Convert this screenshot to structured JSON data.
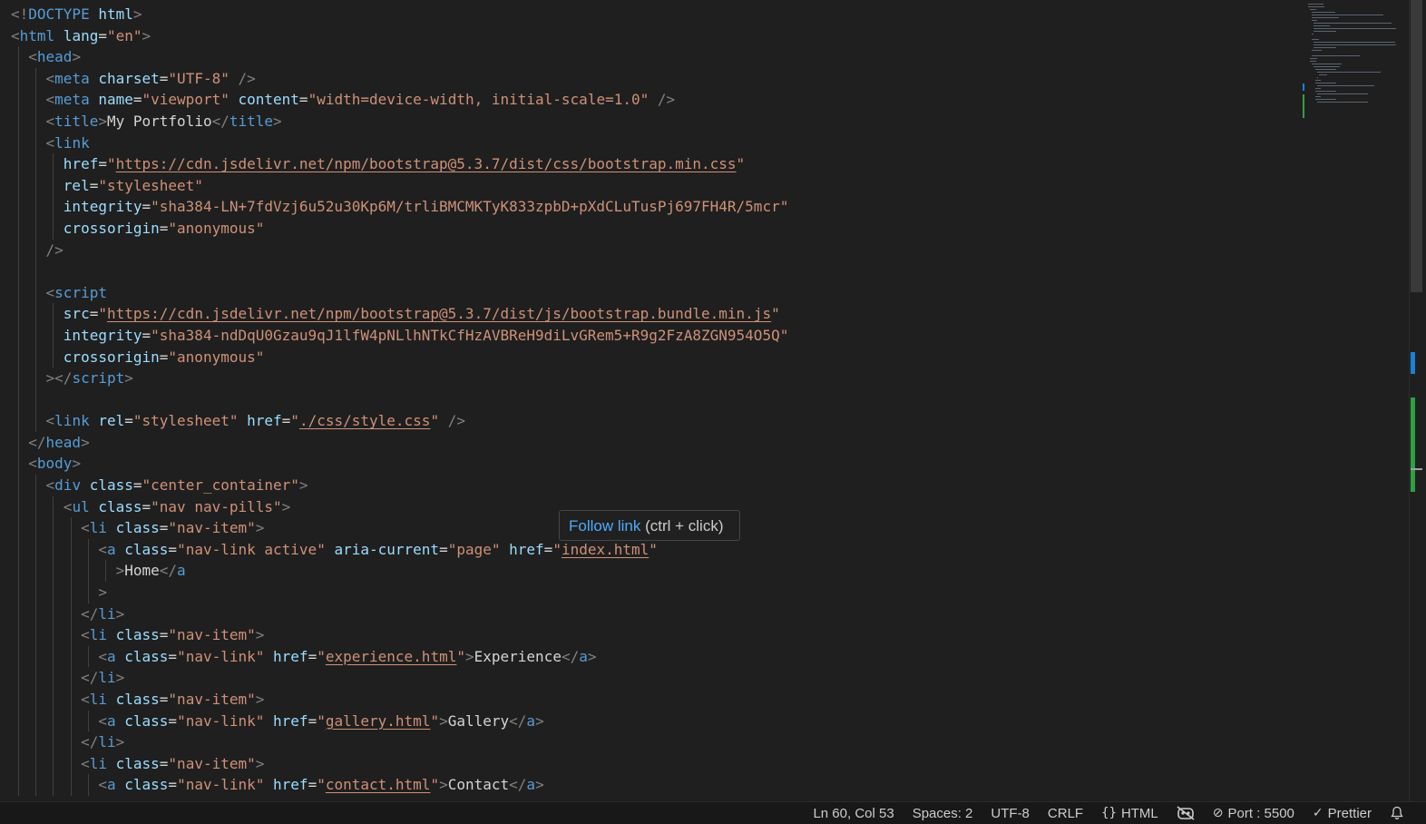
{
  "colors": {
    "background": "#1f1f1f",
    "tag": "#569cd6",
    "attribute": "#9cdcfe",
    "string": "#ce9178",
    "text": "#d4d4d4",
    "punctuation": "#808080",
    "link": "#4daafc"
  },
  "editor": {
    "lines": [
      {
        "indent": 0,
        "tokens": [
          {
            "t": "p",
            "v": "<!"
          },
          {
            "t": "tag",
            "v": "DOCTYPE"
          },
          {
            "t": "txt",
            "v": " "
          },
          {
            "t": "attr",
            "v": "html"
          },
          {
            "t": "p",
            "v": ">"
          }
        ]
      },
      {
        "indent": 0,
        "tokens": [
          {
            "t": "p",
            "v": "<"
          },
          {
            "t": "tag",
            "v": "html"
          },
          {
            "t": "txt",
            "v": " "
          },
          {
            "t": "attr",
            "v": "lang"
          },
          {
            "t": "txt",
            "v": "="
          },
          {
            "t": "str",
            "v": "\"en\""
          },
          {
            "t": "p",
            "v": ">"
          }
        ]
      },
      {
        "indent": 1,
        "tokens": [
          {
            "t": "p",
            "v": "<"
          },
          {
            "t": "tag",
            "v": "head"
          },
          {
            "t": "p",
            "v": ">"
          }
        ]
      },
      {
        "indent": 2,
        "tokens": [
          {
            "t": "p",
            "v": "<"
          },
          {
            "t": "tag",
            "v": "meta"
          },
          {
            "t": "txt",
            "v": " "
          },
          {
            "t": "attr",
            "v": "charset"
          },
          {
            "t": "txt",
            "v": "="
          },
          {
            "t": "str",
            "v": "\"UTF-8\""
          },
          {
            "t": "txt",
            "v": " "
          },
          {
            "t": "p",
            "v": "/>"
          }
        ]
      },
      {
        "indent": 2,
        "tokens": [
          {
            "t": "p",
            "v": "<"
          },
          {
            "t": "tag",
            "v": "meta"
          },
          {
            "t": "txt",
            "v": " "
          },
          {
            "t": "attr",
            "v": "name"
          },
          {
            "t": "txt",
            "v": "="
          },
          {
            "t": "str",
            "v": "\"viewport\""
          },
          {
            "t": "txt",
            "v": " "
          },
          {
            "t": "attr",
            "v": "content"
          },
          {
            "t": "txt",
            "v": "="
          },
          {
            "t": "str",
            "v": "\"width=device-width, initial-scale=1.0\""
          },
          {
            "t": "txt",
            "v": " "
          },
          {
            "t": "p",
            "v": "/>"
          }
        ]
      },
      {
        "indent": 2,
        "tokens": [
          {
            "t": "p",
            "v": "<"
          },
          {
            "t": "tag",
            "v": "title"
          },
          {
            "t": "p",
            "v": ">"
          },
          {
            "t": "txt",
            "v": "My Portfolio"
          },
          {
            "t": "p",
            "v": "</"
          },
          {
            "t": "tag",
            "v": "title"
          },
          {
            "t": "p",
            "v": ">"
          }
        ]
      },
      {
        "indent": 2,
        "tokens": [
          {
            "t": "p",
            "v": "<"
          },
          {
            "t": "tag",
            "v": "link"
          }
        ]
      },
      {
        "indent": 3,
        "tokens": [
          {
            "t": "attr",
            "v": "href"
          },
          {
            "t": "txt",
            "v": "="
          },
          {
            "t": "str",
            "v": "\""
          },
          {
            "t": "str",
            "v": "https://cdn.jsdelivr.net/npm/bootstrap@5.3.7/dist/css/bootstrap.min.css",
            "link": true
          },
          {
            "t": "str",
            "v": "\""
          }
        ]
      },
      {
        "indent": 3,
        "tokens": [
          {
            "t": "attr",
            "v": "rel"
          },
          {
            "t": "txt",
            "v": "="
          },
          {
            "t": "str",
            "v": "\"stylesheet\""
          }
        ]
      },
      {
        "indent": 3,
        "tokens": [
          {
            "t": "attr",
            "v": "integrity"
          },
          {
            "t": "txt",
            "v": "="
          },
          {
            "t": "str",
            "v": "\"sha384-LN+7fdVzj6u52u30Kp6M/trliBMCMKTyK833zpbD+pXdCLuTusPj697FH4R/5mcr\""
          }
        ]
      },
      {
        "indent": 3,
        "tokens": [
          {
            "t": "attr",
            "v": "crossorigin"
          },
          {
            "t": "txt",
            "v": "="
          },
          {
            "t": "str",
            "v": "\"anonymous\""
          }
        ]
      },
      {
        "indent": 2,
        "tokens": [
          {
            "t": "p",
            "v": "/>"
          }
        ]
      },
      {
        "indent": 2,
        "tokens": []
      },
      {
        "indent": 2,
        "tokens": [
          {
            "t": "p",
            "v": "<"
          },
          {
            "t": "tag",
            "v": "script"
          }
        ]
      },
      {
        "indent": 3,
        "tokens": [
          {
            "t": "attr",
            "v": "src"
          },
          {
            "t": "txt",
            "v": "="
          },
          {
            "t": "str",
            "v": "\""
          },
          {
            "t": "str",
            "v": "https://cdn.jsdelivr.net/npm/bootstrap@5.3.7/dist/js/bootstrap.bundle.min.js",
            "link": true
          },
          {
            "t": "str",
            "v": "\""
          }
        ]
      },
      {
        "indent": 3,
        "tokens": [
          {
            "t": "attr",
            "v": "integrity"
          },
          {
            "t": "txt",
            "v": "="
          },
          {
            "t": "str",
            "v": "\"sha384-ndDqU0Gzau9qJ1lfW4pNLlhNTkCfHzAVBReH9diLvGRem5+R9g2FzA8ZGN954O5Q\""
          }
        ]
      },
      {
        "indent": 3,
        "tokens": [
          {
            "t": "attr",
            "v": "crossorigin"
          },
          {
            "t": "txt",
            "v": "="
          },
          {
            "t": "str",
            "v": "\"anonymous\""
          }
        ]
      },
      {
        "indent": 2,
        "tokens": [
          {
            "t": "p",
            "v": "></"
          },
          {
            "t": "tag",
            "v": "script"
          },
          {
            "t": "p",
            "v": ">"
          }
        ]
      },
      {
        "indent": 2,
        "tokens": []
      },
      {
        "indent": 2,
        "tokens": [
          {
            "t": "p",
            "v": "<"
          },
          {
            "t": "tag",
            "v": "link"
          },
          {
            "t": "txt",
            "v": " "
          },
          {
            "t": "attr",
            "v": "rel"
          },
          {
            "t": "txt",
            "v": "="
          },
          {
            "t": "str",
            "v": "\"stylesheet\""
          },
          {
            "t": "txt",
            "v": " "
          },
          {
            "t": "attr",
            "v": "href"
          },
          {
            "t": "txt",
            "v": "="
          },
          {
            "t": "str",
            "v": "\""
          },
          {
            "t": "str",
            "v": "./css/style.css",
            "link": true
          },
          {
            "t": "str",
            "v": "\""
          },
          {
            "t": "txt",
            "v": " "
          },
          {
            "t": "p",
            "v": "/>"
          }
        ]
      },
      {
        "indent": 1,
        "tokens": [
          {
            "t": "p",
            "v": "</"
          },
          {
            "t": "tag",
            "v": "head"
          },
          {
            "t": "p",
            "v": ">"
          }
        ]
      },
      {
        "indent": 1,
        "tokens": [
          {
            "t": "p",
            "v": "<"
          },
          {
            "t": "tag",
            "v": "body"
          },
          {
            "t": "p",
            "v": ">"
          }
        ]
      },
      {
        "indent": 2,
        "tokens": [
          {
            "t": "p",
            "v": "<"
          },
          {
            "t": "tag",
            "v": "div"
          },
          {
            "t": "txt",
            "v": " "
          },
          {
            "t": "attr",
            "v": "class"
          },
          {
            "t": "txt",
            "v": "="
          },
          {
            "t": "str",
            "v": "\"center_container\""
          },
          {
            "t": "p",
            "v": ">"
          }
        ]
      },
      {
        "indent": 3,
        "tokens": [
          {
            "t": "p",
            "v": "<"
          },
          {
            "t": "tag",
            "v": "ul"
          },
          {
            "t": "txt",
            "v": " "
          },
          {
            "t": "attr",
            "v": "class"
          },
          {
            "t": "txt",
            "v": "="
          },
          {
            "t": "str",
            "v": "\"nav nav-pills\""
          },
          {
            "t": "p",
            "v": ">"
          }
        ]
      },
      {
        "indent": 4,
        "tokens": [
          {
            "t": "p",
            "v": "<"
          },
          {
            "t": "tag",
            "v": "li"
          },
          {
            "t": "txt",
            "v": " "
          },
          {
            "t": "attr",
            "v": "class"
          },
          {
            "t": "txt",
            "v": "="
          },
          {
            "t": "str",
            "v": "\"nav-item\""
          },
          {
            "t": "p",
            "v": ">"
          }
        ]
      },
      {
        "indent": 5,
        "tokens": [
          {
            "t": "p",
            "v": "<"
          },
          {
            "t": "tag",
            "v": "a"
          },
          {
            "t": "txt",
            "v": " "
          },
          {
            "t": "attr",
            "v": "class"
          },
          {
            "t": "txt",
            "v": "="
          },
          {
            "t": "str",
            "v": "\"nav-link active\""
          },
          {
            "t": "txt",
            "v": " "
          },
          {
            "t": "attr",
            "v": "aria-current"
          },
          {
            "t": "txt",
            "v": "="
          },
          {
            "t": "str",
            "v": "\"page\""
          },
          {
            "t": "txt",
            "v": " "
          },
          {
            "t": "attr",
            "v": "href"
          },
          {
            "t": "txt",
            "v": "="
          },
          {
            "t": "str",
            "v": "\""
          },
          {
            "t": "str",
            "v": "index.html",
            "link": true
          },
          {
            "t": "str",
            "v": "\""
          }
        ]
      },
      {
        "indent": 6,
        "tokens": [
          {
            "t": "p",
            "v": ">"
          },
          {
            "t": "txt",
            "v": "Home"
          },
          {
            "t": "p",
            "v": "</"
          },
          {
            "t": "tag",
            "v": "a"
          }
        ]
      },
      {
        "indent": 5,
        "tokens": [
          {
            "t": "p",
            "v": ">"
          }
        ]
      },
      {
        "indent": 4,
        "tokens": [
          {
            "t": "p",
            "v": "</"
          },
          {
            "t": "tag",
            "v": "li"
          },
          {
            "t": "p",
            "v": ">"
          }
        ]
      },
      {
        "indent": 4,
        "tokens": [
          {
            "t": "p",
            "v": "<"
          },
          {
            "t": "tag",
            "v": "li"
          },
          {
            "t": "txt",
            "v": " "
          },
          {
            "t": "attr",
            "v": "class"
          },
          {
            "t": "txt",
            "v": "="
          },
          {
            "t": "str",
            "v": "\"nav-item\""
          },
          {
            "t": "p",
            "v": ">"
          }
        ]
      },
      {
        "indent": 5,
        "tokens": [
          {
            "t": "p",
            "v": "<"
          },
          {
            "t": "tag",
            "v": "a"
          },
          {
            "t": "txt",
            "v": " "
          },
          {
            "t": "attr",
            "v": "class"
          },
          {
            "t": "txt",
            "v": "="
          },
          {
            "t": "str",
            "v": "\"nav-link\""
          },
          {
            "t": "txt",
            "v": " "
          },
          {
            "t": "attr",
            "v": "href"
          },
          {
            "t": "txt",
            "v": "="
          },
          {
            "t": "str",
            "v": "\""
          },
          {
            "t": "str",
            "v": "experience.html",
            "link": true
          },
          {
            "t": "str",
            "v": "\""
          },
          {
            "t": "p",
            "v": ">"
          },
          {
            "t": "txt",
            "v": "Experience"
          },
          {
            "t": "p",
            "v": "</"
          },
          {
            "t": "tag",
            "v": "a"
          },
          {
            "t": "p",
            "v": ">"
          }
        ]
      },
      {
        "indent": 4,
        "tokens": [
          {
            "t": "p",
            "v": "</"
          },
          {
            "t": "tag",
            "v": "li"
          },
          {
            "t": "p",
            "v": ">"
          }
        ]
      },
      {
        "indent": 4,
        "tokens": [
          {
            "t": "p",
            "v": "<"
          },
          {
            "t": "tag",
            "v": "li"
          },
          {
            "t": "txt",
            "v": " "
          },
          {
            "t": "attr",
            "v": "class"
          },
          {
            "t": "txt",
            "v": "="
          },
          {
            "t": "str",
            "v": "\"nav-item\""
          },
          {
            "t": "p",
            "v": ">"
          }
        ]
      },
      {
        "indent": 5,
        "tokens": [
          {
            "t": "p",
            "v": "<"
          },
          {
            "t": "tag",
            "v": "a"
          },
          {
            "t": "txt",
            "v": " "
          },
          {
            "t": "attr",
            "v": "class"
          },
          {
            "t": "txt",
            "v": "="
          },
          {
            "t": "str",
            "v": "\"nav-link\""
          },
          {
            "t": "txt",
            "v": " "
          },
          {
            "t": "attr",
            "v": "href"
          },
          {
            "t": "txt",
            "v": "="
          },
          {
            "t": "str",
            "v": "\""
          },
          {
            "t": "str",
            "v": "gallery.html",
            "link": true
          },
          {
            "t": "str",
            "v": "\""
          },
          {
            "t": "p",
            "v": ">"
          },
          {
            "t": "txt",
            "v": "Gallery"
          },
          {
            "t": "p",
            "v": "</"
          },
          {
            "t": "tag",
            "v": "a"
          },
          {
            "t": "p",
            "v": ">"
          }
        ]
      },
      {
        "indent": 4,
        "tokens": [
          {
            "t": "p",
            "v": "</"
          },
          {
            "t": "tag",
            "v": "li"
          },
          {
            "t": "p",
            "v": ">"
          }
        ]
      },
      {
        "indent": 4,
        "tokens": [
          {
            "t": "p",
            "v": "<"
          },
          {
            "t": "tag",
            "v": "li"
          },
          {
            "t": "txt",
            "v": " "
          },
          {
            "t": "attr",
            "v": "class"
          },
          {
            "t": "txt",
            "v": "="
          },
          {
            "t": "str",
            "v": "\"nav-item\""
          },
          {
            "t": "p",
            "v": ">"
          }
        ]
      },
      {
        "indent": 5,
        "tokens": [
          {
            "t": "p",
            "v": "<"
          },
          {
            "t": "tag",
            "v": "a"
          },
          {
            "t": "txt",
            "v": " "
          },
          {
            "t": "attr",
            "v": "class"
          },
          {
            "t": "txt",
            "v": "="
          },
          {
            "t": "str",
            "v": "\"nav-link\""
          },
          {
            "t": "txt",
            "v": " "
          },
          {
            "t": "attr",
            "v": "href"
          },
          {
            "t": "txt",
            "v": "="
          },
          {
            "t": "str",
            "v": "\""
          },
          {
            "t": "str",
            "v": "contact.html",
            "link": true
          },
          {
            "t": "str",
            "v": "\""
          },
          {
            "t": "p",
            "v": ">"
          },
          {
            "t": "txt",
            "v": "Contact"
          },
          {
            "t": "p",
            "v": "</"
          },
          {
            "t": "tag",
            "v": "a"
          },
          {
            "t": "p",
            "v": ">"
          }
        ]
      }
    ]
  },
  "hover": {
    "link_text": "Follow link",
    "hint_text": " (ctrl + click)"
  },
  "status_bar": {
    "position": "Ln 60, Col 53",
    "spaces": "Spaces: 2",
    "encoding": "UTF-8",
    "eol": "CRLF",
    "language_icon": "braces-icon",
    "language": "HTML",
    "copilot_icon": "copilot-icon",
    "port_icon": "circle-slash-icon",
    "port": "Port : 5500",
    "prettier_icon": "check-double-icon",
    "prettier": "Prettier",
    "notification_icon": "bell-icon"
  }
}
